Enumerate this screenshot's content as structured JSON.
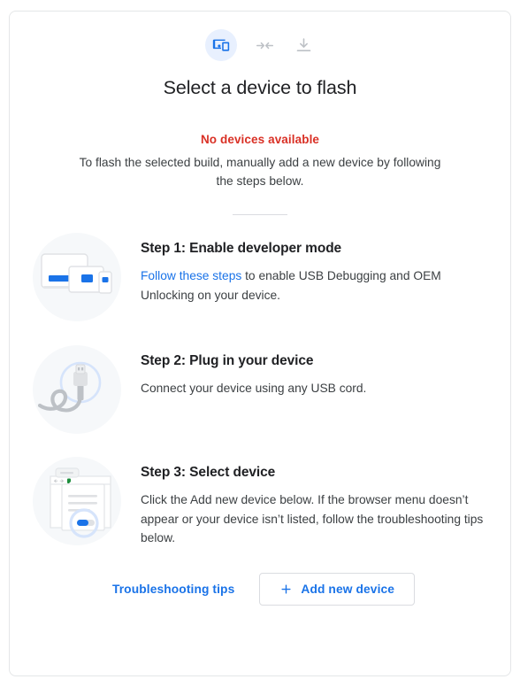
{
  "header": {
    "icons": [
      {
        "name": "devices-icon",
        "state": "active"
      },
      {
        "name": "compress-arrows-icon",
        "state": "inactive"
      },
      {
        "name": "download-icon",
        "state": "inactive"
      }
    ],
    "title": "Select a device to flash"
  },
  "status": {
    "message": "No devices available",
    "message_color": "#d93025",
    "description": "To flash the selected build, manually add a new device by following the steps below."
  },
  "steps": [
    {
      "art": "devices-illustration",
      "title": "Step 1: Enable developer mode",
      "link_text": "Follow these steps",
      "desc_rest": " to enable USB Debugging and OEM Unlocking on your device."
    },
    {
      "art": "usb-cable-illustration",
      "title": "Step 2: Plug in your device",
      "link_text": "",
      "desc_rest": "Connect your device using any USB cord."
    },
    {
      "art": "browser-select-illustration",
      "title": "Step 3: Select device",
      "link_text": "",
      "desc_rest": "Click the Add new device below. If the browser menu doesn’t appear or your device isn’t listed, follow the troubleshooting tips below."
    }
  ],
  "footer": {
    "troubleshooting_label": "Troubleshooting tips",
    "add_device_label": "Add new device",
    "add_device_icon": "plus-icon"
  },
  "colors": {
    "accent_blue": "#1a73e8",
    "error_red": "#d93025",
    "icon_gray": "#bdc1c6",
    "art_bg": "#f6f8fa"
  }
}
